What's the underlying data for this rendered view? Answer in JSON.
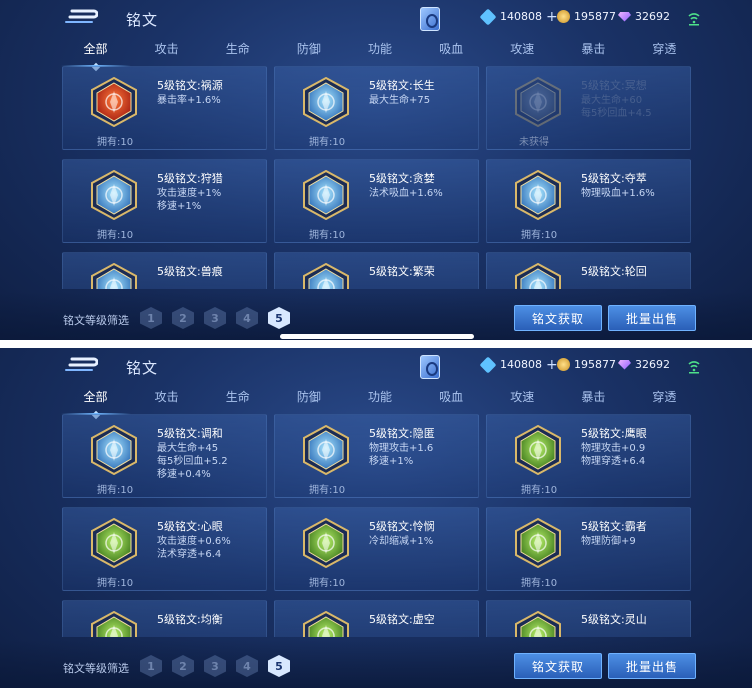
{
  "header": {
    "title": "铭文",
    "gem_value": "140808",
    "gold_value": "195877",
    "diamond_value": "32692"
  },
  "tabs": [
    "全部",
    "攻击",
    "生命",
    "防御",
    "功能",
    "吸血",
    "攻速",
    "暴击",
    "穿透"
  ],
  "filter": {
    "label": "铭文等级筛选",
    "levels": [
      "1",
      "2",
      "3",
      "4",
      "5"
    ]
  },
  "buttons": {
    "obtain": "铭文获取",
    "sell": "批量出售"
  },
  "colors": {
    "accent": "#4d8fe4",
    "background": "#1a3266"
  },
  "screens": [
    {
      "runes": [
        {
          "name": "5级铭文:祸源",
          "attrs": [
            "暴击率+1.6%"
          ],
          "owned": "拥有:10",
          "icon": "red-flame-rune-icon"
        },
        {
          "name": "5级铭文:长生",
          "attrs": [
            "最大生命+75"
          ],
          "owned": "拥有:10",
          "icon": "blue-leaf-rune-icon"
        },
        {
          "name": "5级铭文:冥想",
          "attrs": [
            "最大生命+60",
            "每5秒回血+4.5"
          ],
          "owned": "未获得",
          "icon": "grey-web-rune-icon",
          "locked": true
        },
        {
          "name": "5级铭文:狩猎",
          "attrs": [
            "攻击速度+1%",
            "移速+1%"
          ],
          "owned": "拥有:10",
          "icon": "blue-wing-rune-icon"
        },
        {
          "name": "5级铭文:贪婪",
          "attrs": [
            "法术吸血+1.6%"
          ],
          "owned": "拥有:10",
          "icon": "blue-triangle-rune-icon"
        },
        {
          "name": "5级铭文:夺萃",
          "attrs": [
            "物理吸血+1.6%"
          ],
          "owned": "拥有:10",
          "icon": "blue-knot-rune-icon"
        },
        {
          "name": "5级铭文:兽痕",
          "attrs": [],
          "owned": "",
          "icon": "blue-claw-rune-icon"
        },
        {
          "name": "5级铭文:繁荣",
          "attrs": [],
          "owned": "",
          "icon": "blue-star-rune-icon"
        },
        {
          "name": "5级铭文:轮回",
          "attrs": [],
          "owned": "",
          "icon": "blue-ring-rune-icon"
        }
      ]
    },
    {
      "runes": [
        {
          "name": "5级铭文:调和",
          "attrs": [
            "最大生命+45",
            "每5秒回血+5.2",
            "移速+0.4%"
          ],
          "owned": "拥有:10",
          "icon": "blue-drop-rune-icon"
        },
        {
          "name": "5级铭文:隐匿",
          "attrs": [
            "物理攻击+1.6",
            "移速+1%"
          ],
          "owned": "拥有:10",
          "icon": "blue-flame-rune-icon"
        },
        {
          "name": "5级铭文:鹰眼",
          "attrs": [
            "物理攻击+0.9",
            "物理穿透+6.4"
          ],
          "owned": "拥有:10",
          "icon": "green-flower-rune-icon"
        },
        {
          "name": "5级铭文:心眼",
          "attrs": [
            "攻击速度+0.6%",
            "法术穿透+6.4"
          ],
          "owned": "拥有:10",
          "icon": "green-eye-rune-icon"
        },
        {
          "name": "5级铭文:怜悯",
          "attrs": [
            "冷却缩减+1%"
          ],
          "owned": "拥有:10",
          "icon": "green-star-rune-icon"
        },
        {
          "name": "5级铭文:霸者",
          "attrs": [
            "物理防御+9"
          ],
          "owned": "拥有:10",
          "icon": "green-shield-rune-icon"
        },
        {
          "name": "5级铭文:均衡",
          "attrs": [],
          "owned": "",
          "icon": "green-balance-rune-icon"
        },
        {
          "name": "5级铭文:虚空",
          "attrs": [],
          "owned": "",
          "icon": "green-void-rune-icon"
        },
        {
          "name": "5级铭文:灵山",
          "attrs": [],
          "owned": "",
          "icon": "green-mountain-rune-icon"
        }
      ]
    }
  ]
}
